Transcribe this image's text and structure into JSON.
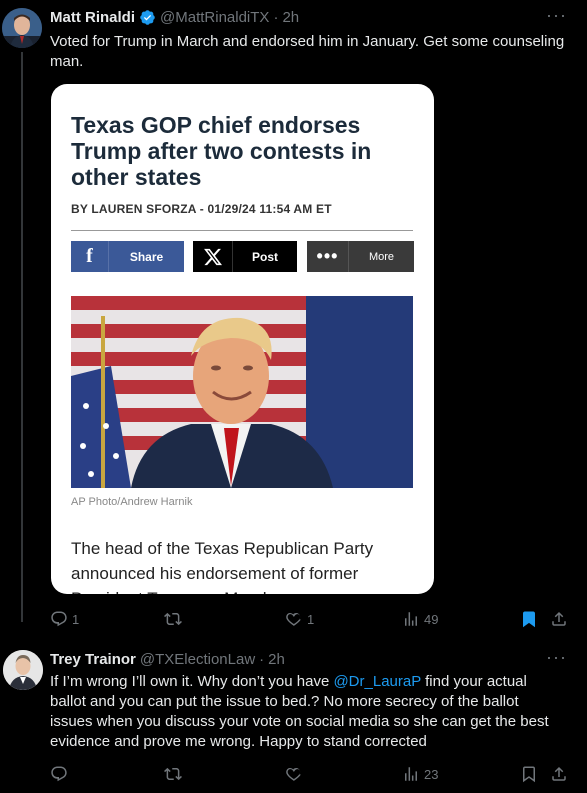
{
  "tweet1": {
    "name": "Matt Rinaldi",
    "handle": "@MattRinaldiTX",
    "time": "2h",
    "text": "Voted for Trump in March and endorsed him in January. Get some counseling man.",
    "card": {
      "headline": "Texas GOP chief endorses Trump after two contests in other states",
      "byline": "BY LAUREN SFORZA - 01/29/24 11:54 AM ET",
      "share_facebook": "Share",
      "share_x": "Post",
      "share_more": "More",
      "photo_credit": "AP Photo/Andrew Harnik",
      "body": "The head of the Texas Republican Party announced his endorsement of former President Trump on Monday"
    },
    "stats": {
      "replies": "1",
      "retweets": "",
      "likes": "1",
      "views": "49"
    }
  },
  "tweet2": {
    "name": "Trey Trainor",
    "handle": "@TXElectionLaw",
    "time": "2h",
    "text_before": "If I’m wrong I’ll own it. Why don’t you have ",
    "mention": "@Dr_LauraP",
    "text_after": " find your actual ballot and you can put the issue to bed.?  No more secrecy of the ballot issues when you discuss your vote on social media so she can get the best evidence and prove me wrong.  Happy to stand corrected",
    "stats": {
      "replies": "",
      "retweets": "",
      "likes": "",
      "views": "23"
    }
  },
  "separator": "·",
  "colors": {
    "background": "#000000",
    "text": "#e7e9ea",
    "muted": "#71767b",
    "accent": "#1d9bf0"
  },
  "icons": [
    "verified-badge-icon",
    "more-icon",
    "reply-icon",
    "retweet-icon",
    "like-icon",
    "views-icon",
    "bookmark-icon",
    "share-icon",
    "facebook-icon",
    "x-logo-icon"
  ]
}
